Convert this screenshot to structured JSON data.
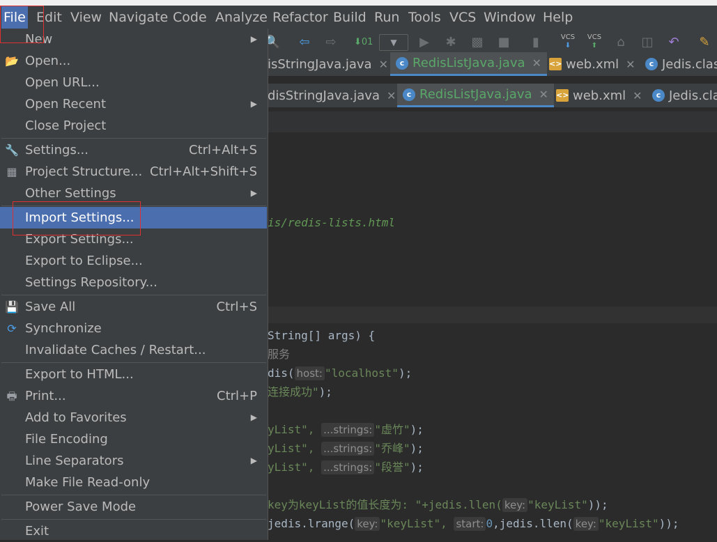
{
  "menubar": [
    {
      "label": "File",
      "underline": "F"
    },
    {
      "label": "Edit",
      "underline": "E"
    },
    {
      "label": "View",
      "underline": "V"
    },
    {
      "label": "Navigate",
      "underline": "N"
    },
    {
      "label": "Code",
      "underline": "C"
    },
    {
      "label": "Analyze",
      "underline": "z"
    },
    {
      "label": "Refactor",
      "underline": "R"
    },
    {
      "label": "Build",
      "underline": "B"
    },
    {
      "label": "Run",
      "underline": "u"
    },
    {
      "label": "Tools",
      "underline": "T"
    },
    {
      "label": "VCS",
      "underline": "S"
    },
    {
      "label": "Window",
      "underline": "W"
    },
    {
      "label": "Help",
      "underline": "H"
    }
  ],
  "file_menu": {
    "new": "New",
    "open": "Open...",
    "open_url": "Open URL...",
    "open_recent": "Open Recent",
    "close_project": "Close Project",
    "settings": "Settings...",
    "settings_shortcut": "Ctrl+Alt+S",
    "project_structure": "Project Structure...",
    "project_structure_shortcut": "Ctrl+Alt+Shift+S",
    "other_settings": "Other Settings",
    "import_settings": "Import Settings...",
    "export_settings": "Export Settings...",
    "export_eclipse": "Export to Eclipse...",
    "settings_repository": "Settings Repository...",
    "save_all": "Save All",
    "save_all_shortcut": "Ctrl+S",
    "synchronize": "Synchronize",
    "invalidate_caches": "Invalidate Caches / Restart...",
    "export_html": "Export to HTML...",
    "print": "Print...",
    "print_shortcut": "Ctrl+P",
    "add_favorites": "Add to Favorites",
    "file_encoding": "File Encoding",
    "line_separators": "Line Separators",
    "make_read_only": "Make File Read-only",
    "power_save": "Power Save Mode",
    "exit": "Exit"
  },
  "tabs_row1": [
    {
      "label": "isStringJava.java"
    },
    {
      "label": "RedisListJava.java"
    },
    {
      "label": "web.xml"
    },
    {
      "label": "Jedis.clas"
    }
  ],
  "tabs_row2": [
    {
      "label": "disStringJava.java"
    },
    {
      "label": "RedisListJava.java"
    },
    {
      "label": "web.xml"
    },
    {
      "label": "Jedis.cla"
    }
  ],
  "toolbar": {
    "vcs1": "VCS",
    "vcs2": "VCS"
  },
  "code": {
    "comment_url": "is/redis-lists.html",
    "l1": "String[] args) {",
    "l2": "服务",
    "l3a": "dis(",
    "hint_host": "host:",
    "l3b": "\"localhost\"",
    "l3c": ");",
    "l4a": "连接成功\"",
    "l4b": ");",
    "l5a": "yList\",",
    "hint_strings": "...strings:",
    "l5b": "\"虚竹\"",
    "l6b": "\"乔峰\"",
    "l7b": "\"段誉\"",
    "l_end": ");",
    "l8a": "key为keyList的值长度为: \"+jedis.llen(",
    "hint_key": "key:",
    "l8b": "\"keyList\"",
    "l8c": "));",
    "l9a": "jedis.lrange(",
    "l9b": "\"keyList\",",
    "hint_start": "start:",
    "l9c": "0",
    "l9d": ",jedis.llen(",
    "l9e": "\"keyList\"",
    "l9f": "));"
  }
}
